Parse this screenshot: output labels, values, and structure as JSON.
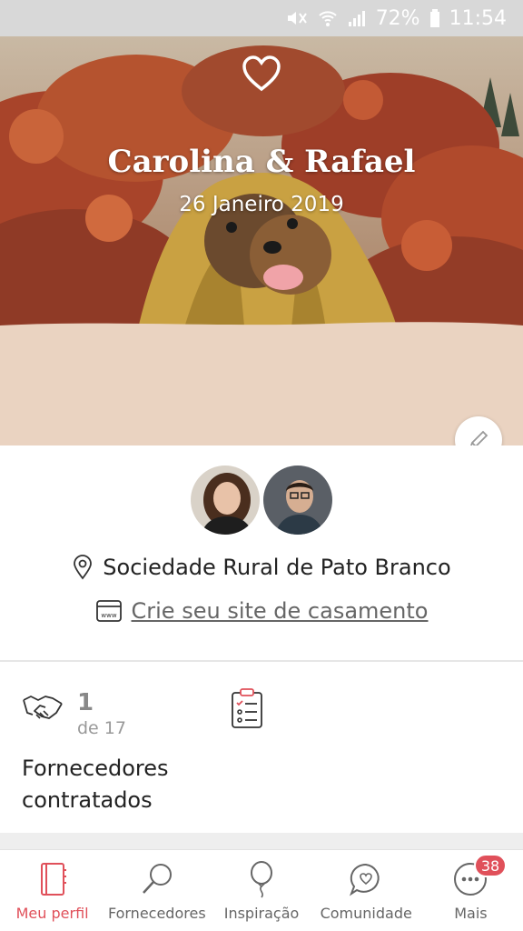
{
  "status_bar": {
    "battery": "72%",
    "time": "11:54"
  },
  "hero": {
    "couple_names": "Carolina & Rafael",
    "date": "26 Janeiro 2019"
  },
  "profile": {
    "venue": "Sociedade Rural de Pato Branco",
    "website_link": "Crie seu site de casamento"
  },
  "suppliers": {
    "count": "1",
    "of_total": "de 17",
    "label_line1": "Fornecedores",
    "label_line2": "contratados"
  },
  "bottom_nav": {
    "items": [
      {
        "label": "Meu perfil",
        "icon": "notebook-icon",
        "active": true
      },
      {
        "label": "Fornecedores",
        "icon": "search-icon",
        "active": false
      },
      {
        "label": "Inspiração",
        "icon": "balloon-icon",
        "active": false
      },
      {
        "label": "Comunidade",
        "icon": "chat-heart-icon",
        "active": false
      },
      {
        "label": "Mais",
        "icon": "more-icon",
        "active": false
      }
    ],
    "badge": "38"
  },
  "colors": {
    "accent": "#e0505a",
    "hero_band": "#ead3c1"
  }
}
